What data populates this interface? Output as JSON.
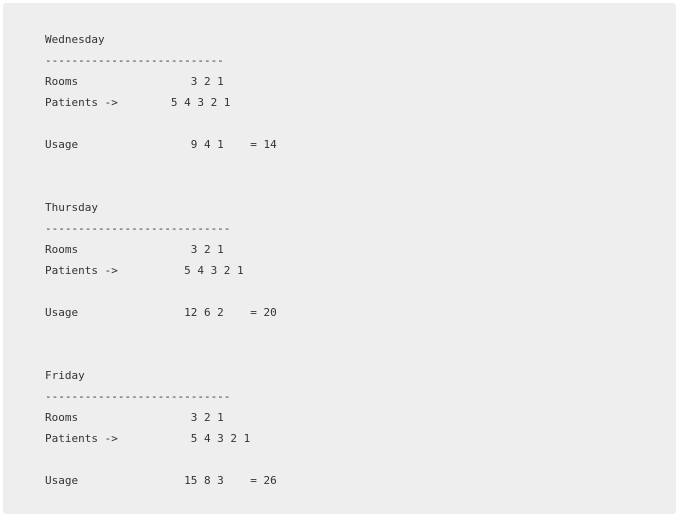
{
  "lines": [
    "Wednesday",
    "---------------------------",
    "Rooms                 3 2 1",
    "Patients ->        5 4 3 2 1",
    "",
    "Usage                 9 4 1    = 14",
    "",
    "",
    "Thursday",
    "----------------------------",
    "Rooms                 3 2 1",
    "Patients ->          5 4 3 2 1",
    "",
    "Usage                12 6 2    = 20",
    "",
    "",
    "Friday",
    "----------------------------",
    "Rooms                 3 2 1",
    "Patients ->           5 4 3 2 1",
    "",
    "Usage                15 8 3    = 26"
  ]
}
